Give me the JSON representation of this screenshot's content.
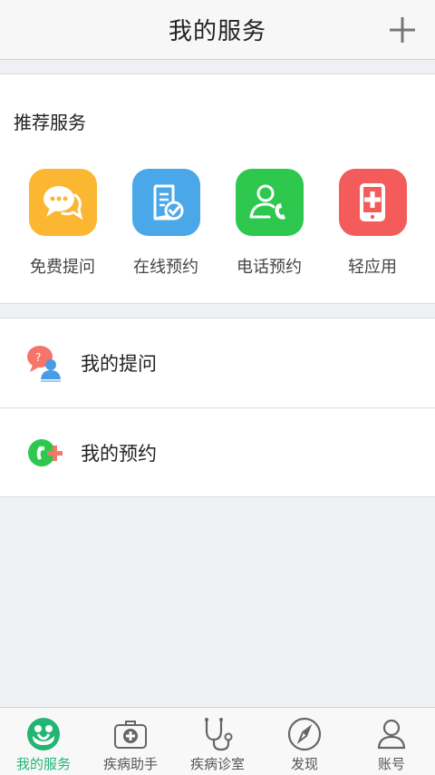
{
  "header": {
    "title": "我的服务",
    "add_icon": "plus-icon"
  },
  "recommended": {
    "title": "推荐服务",
    "items": [
      {
        "label": "免费提问",
        "icon": "chat-bubbles-icon",
        "color": "#fbb632"
      },
      {
        "label": "在线预约",
        "icon": "document-check-icon",
        "color": "#4aa8e8"
      },
      {
        "label": "电话预约",
        "icon": "person-phone-icon",
        "color": "#2ec84e"
      },
      {
        "label": "轻应用",
        "icon": "phone-medical-icon",
        "color": "#f45b5b"
      }
    ]
  },
  "my_list": [
    {
      "label": "我的提问",
      "icon": "question-person-icon"
    },
    {
      "label": "我的预约",
      "icon": "phone-plus-icon"
    }
  ],
  "tabbar": {
    "tabs": [
      {
        "label": "我的服务",
        "icon": "my-service-icon",
        "active": true
      },
      {
        "label": "疾病助手",
        "icon": "medical-kit-icon",
        "active": false
      },
      {
        "label": "疾病诊室",
        "icon": "stethoscope-icon",
        "active": false
      },
      {
        "label": "发现",
        "icon": "compass-icon",
        "active": false
      },
      {
        "label": "账号",
        "icon": "user-icon",
        "active": false
      }
    ],
    "active_color": "#22b573"
  }
}
